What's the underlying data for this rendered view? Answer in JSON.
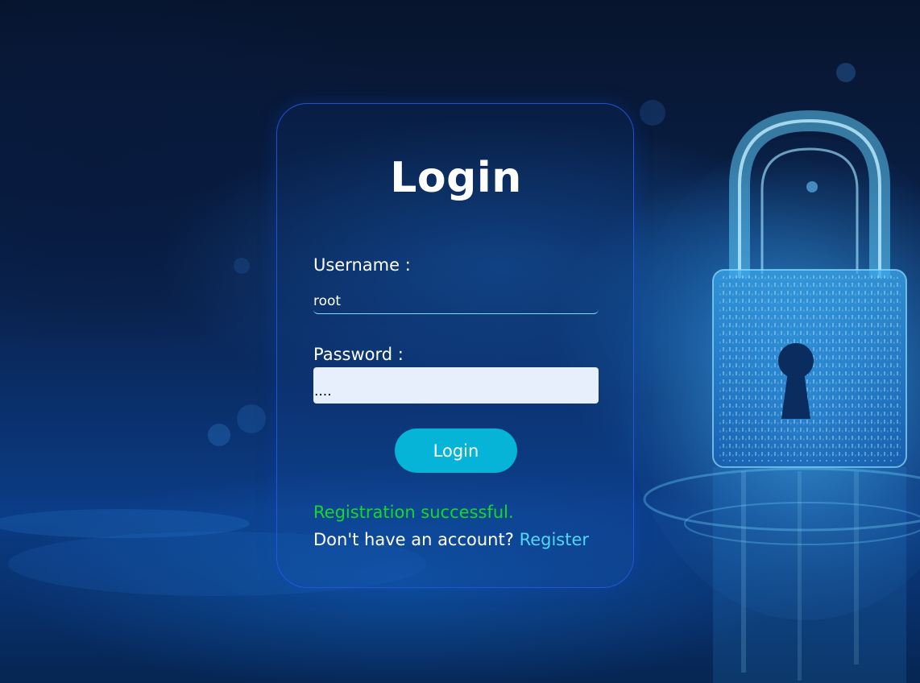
{
  "login_form": {
    "title": "Login",
    "username_label": "Username :",
    "username_value": "root",
    "password_label": "Password :",
    "password_value": "....",
    "submit_label": "Login",
    "status_message": "Registration successful.",
    "register_prompt": "Don't have an account?",
    "register_link": "Register"
  },
  "background": {
    "icon": "padlock-icon"
  },
  "colors": {
    "accent": "#06b4d8",
    "success": "#19d62a",
    "link": "#4fd8f5",
    "card_border": "#2a5ae6"
  }
}
